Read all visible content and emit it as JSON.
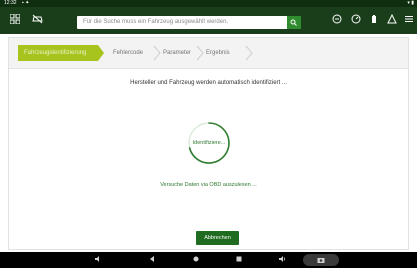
{
  "status_bar": {
    "time": "12:32"
  },
  "app_bar": {
    "search_placeholder": "Für die Suche muss ein Fahrzeug ausgewählt werden."
  },
  "steps": [
    {
      "label": "Fahrzeugidentifizierung",
      "active": true
    },
    {
      "label": "Fehlercode",
      "active": false
    },
    {
      "label": "Parameter",
      "active": false
    },
    {
      "label": "Ergebnis",
      "active": false
    }
  ],
  "main": {
    "headline": "Hersteller und Fahrzeug werden automatisch identifiziert ...",
    "spinner_text": "Identifiziere...",
    "status_text": "Versuche Daten via OBD auszulesen ...",
    "abort_label": "Abbrechen"
  },
  "colors": {
    "app_bar": "#1a3d1a",
    "accent_green": "#2e8b2e",
    "active_step": "#a7c31e",
    "button": "#1f6b1f"
  }
}
